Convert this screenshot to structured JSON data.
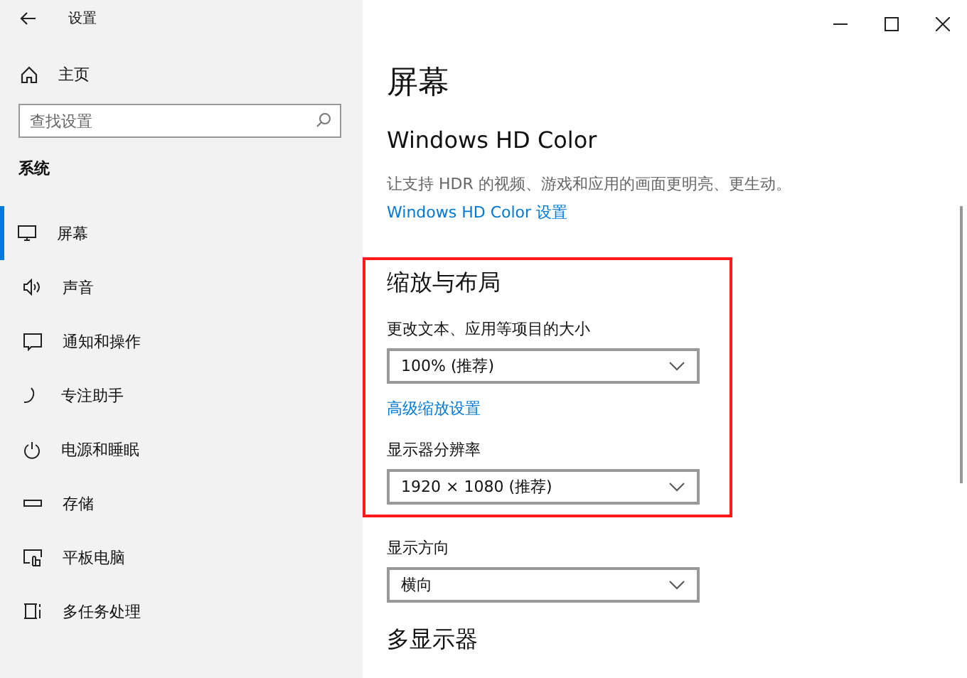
{
  "window": {
    "title": "设置"
  },
  "sidebar": {
    "home": "主页",
    "search": {
      "placeholder": "查找设置"
    },
    "group": "系统",
    "items": [
      {
        "label": "屏幕",
        "selected": true
      },
      {
        "label": "声音",
        "selected": false
      },
      {
        "label": "通知和操作",
        "selected": false
      },
      {
        "label": "专注助手",
        "selected": false
      },
      {
        "label": "电源和睡眠",
        "selected": false
      },
      {
        "label": "存储",
        "selected": false
      },
      {
        "label": "平板电脑",
        "selected": false
      },
      {
        "label": "多任务处理",
        "selected": false
      }
    ]
  },
  "page": {
    "title": "屏幕",
    "blocks": [
      {
        "kind": "heading",
        "text": "Windows HD Color"
      },
      {
        "kind": "desc",
        "text": "让支持 HDR 的视频、游戏和应用的画面更明亮、更生动。"
      },
      {
        "kind": "link",
        "text": "Windows HD Color 设置"
      },
      {
        "kind": "highlight-start"
      },
      {
        "kind": "heading",
        "text": "缩放与布局"
      },
      {
        "kind": "label",
        "text": "更改文本、应用等项目的大小"
      },
      {
        "kind": "dropdown",
        "text": "100% (推荐)"
      },
      {
        "kind": "link",
        "text": "高级缩放设置"
      },
      {
        "kind": "label",
        "text": "显示器分辨率"
      },
      {
        "kind": "dropdown",
        "text": "1920 × 1080 (推荐)"
      },
      {
        "kind": "highlight-end"
      },
      {
        "kind": "label",
        "text": "显示方向"
      },
      {
        "kind": "dropdown",
        "text": "横向"
      },
      {
        "kind": "heading",
        "text": "多显示器"
      }
    ]
  }
}
